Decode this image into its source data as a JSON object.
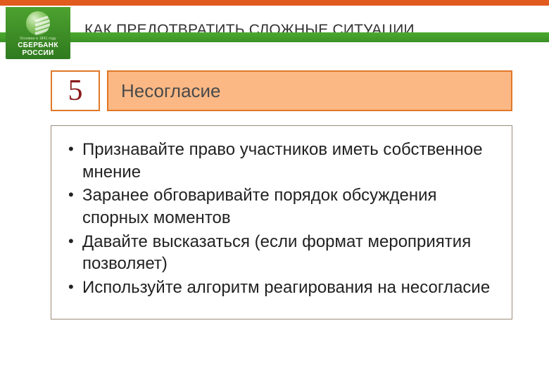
{
  "brand": {
    "tagline": "Основан в 1841 году",
    "name_line1": "СБЕРБАНК",
    "name_line2": "РОССИИ"
  },
  "header": {
    "title": "КАК ПРЕДОТВРАТИТЬ СЛОЖНЫЕ СИТУАЦИИ"
  },
  "section": {
    "number": "5",
    "label": "Несогласие",
    "bullets": [
      "Признавайте право участников иметь собственное мнение",
      "Заранее обговаривайте порядок обсуждения спорных моментов",
      "Давайте высказаться (если формат мероприятия позволяет)",
      "Используйте алгоритм реагирования на несогласие"
    ]
  }
}
